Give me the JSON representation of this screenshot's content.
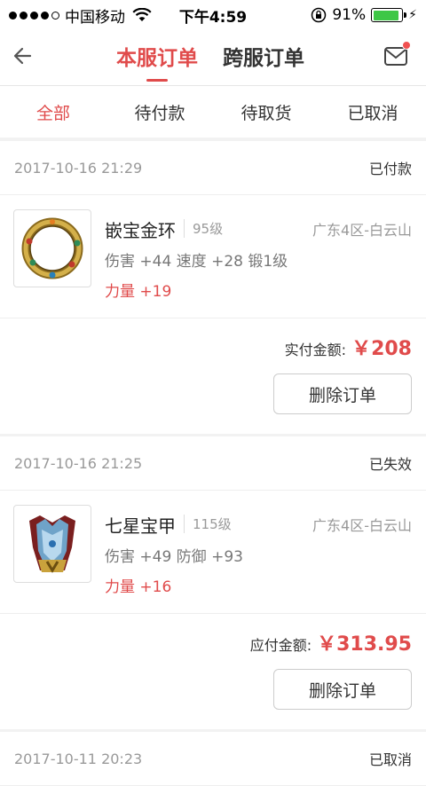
{
  "status": {
    "carrier": "中国移动",
    "time": "下午4:59",
    "battery": "91%",
    "battery_level": 0.91
  },
  "nav": {
    "tabs": [
      "本服订单",
      "跨服订单"
    ],
    "active": 0
  },
  "filters": [
    "全部",
    "待付款",
    "待取货",
    "已取消"
  ],
  "colors": {
    "accent": "#e04b4b",
    "battery": "#3ec746"
  },
  "orders": [
    {
      "time": "2017-10-16 21:29",
      "status": "已付款",
      "name": "嵌宝金环",
      "level": "95级",
      "server": "广东4区-白云山",
      "stats": "伤害 +44 速度 +28 锻1级",
      "attr": "力量 +19",
      "pay_label": "实付金额:",
      "amount": "￥208",
      "button": "删除订单",
      "icon": "gold-ring-icon"
    },
    {
      "time": "2017-10-16 21:25",
      "status": "已失效",
      "name": "七星宝甲",
      "level": "115级",
      "server": "广东4区-白云山",
      "stats": "伤害 +49 防御 +93",
      "attr": "力量 +16",
      "pay_label": "应付金额:",
      "amount": "￥313.95",
      "button": "删除订单",
      "icon": "armor-icon"
    },
    {
      "time": "2017-10-11 20:23",
      "status": "已取消"
    }
  ]
}
